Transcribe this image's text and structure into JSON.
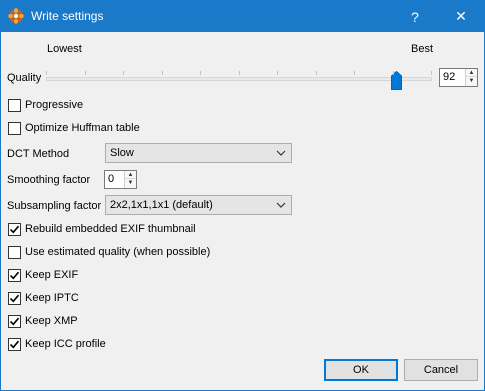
{
  "window": {
    "title": "Write settings",
    "help_label": "?",
    "close_label": "✕"
  },
  "quality": {
    "label": "Quality",
    "min_label": "Lowest",
    "max_label": "Best",
    "value": "92",
    "slider_fraction": 0.92
  },
  "checkboxes": [
    {
      "label": "Progressive",
      "checked": false
    },
    {
      "label": "Optimize Huffman table",
      "checked": false
    },
    {
      "label": "Rebuild embedded EXIF thumbnail",
      "checked": true
    },
    {
      "label": "Use estimated quality (when possible)",
      "checked": false
    },
    {
      "label": "Keep EXIF",
      "checked": true
    },
    {
      "label": "Keep IPTC",
      "checked": true
    },
    {
      "label": "Keep XMP",
      "checked": true
    },
    {
      "label": "Keep ICC profile",
      "checked": true
    }
  ],
  "dct_method": {
    "label": "DCT Method",
    "value": "Slow"
  },
  "smoothing": {
    "label": "Smoothing factor",
    "value": "0"
  },
  "subsampling": {
    "label": "Subsampling factor",
    "value": "2x2,1x1,1x1 (default)"
  },
  "buttons": {
    "ok": "OK",
    "cancel": "Cancel"
  },
  "colors": {
    "accent": "#0078d7",
    "titlebar": "#1a79c9"
  }
}
